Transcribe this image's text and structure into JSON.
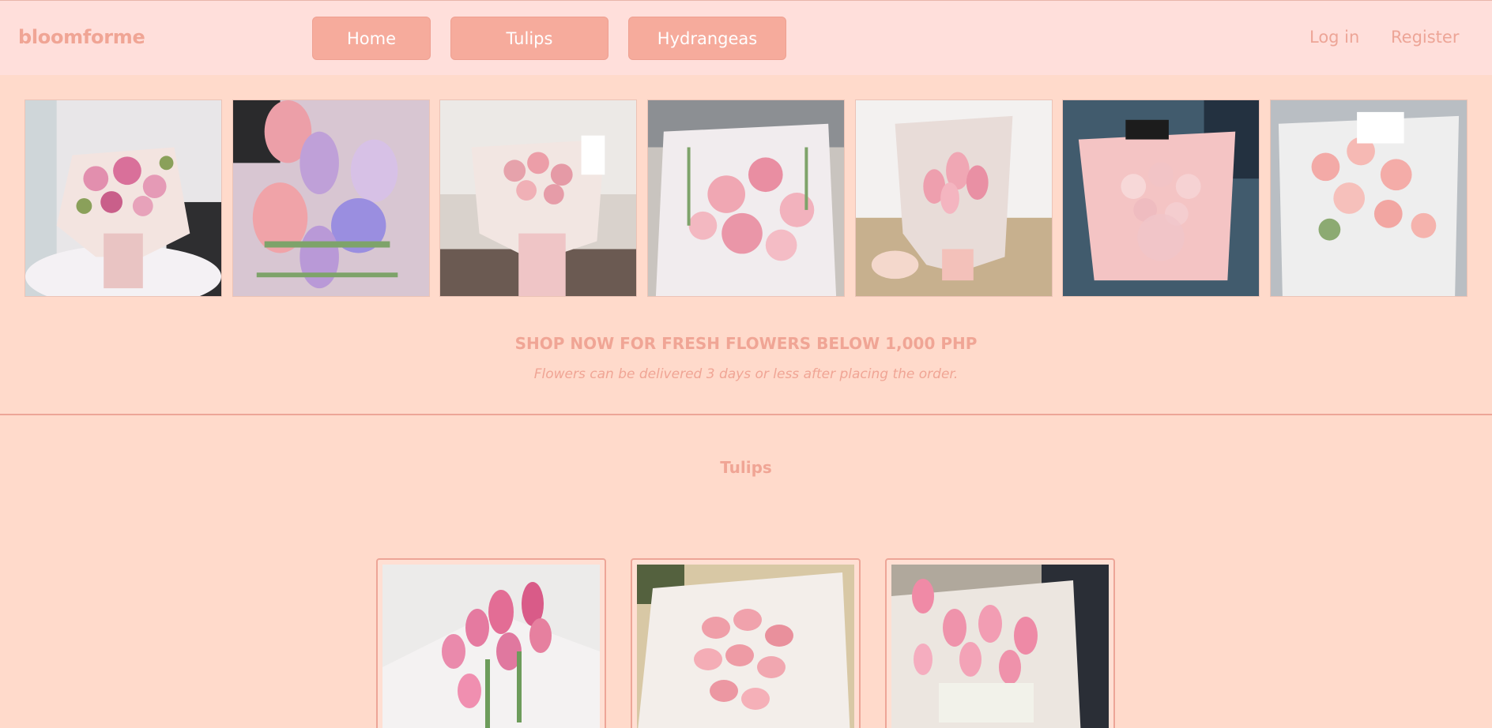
{
  "header": {
    "logo": "bloomforme",
    "nav": [
      "Home",
      "Tulips",
      "Hydrangeas"
    ],
    "auth": {
      "login": "Log in",
      "register": "Register"
    }
  },
  "gallery": {
    "images": [
      "pink lily bouquet",
      "pink and purple tulips",
      "pink rose bouquet",
      "pink carnation bouquet",
      "pink tulip bouquet in hand",
      "pink roses with baby's breath",
      "peach carnation bouquet"
    ]
  },
  "promo": {
    "title": "SHOP NOW FOR FRESH FLOWERS BELOW 1,000 PHP",
    "subtitle": "Flowers can be delivered 3 days or less after placing the order."
  },
  "section": {
    "title": "Tulips"
  },
  "products": [
    {
      "image": "pink tulips on white"
    },
    {
      "image": "pink tulips in paper wrap"
    },
    {
      "image": "pink tulips bouquet dark background"
    }
  ],
  "colors": {
    "background": "#ffdacb",
    "header": "#ffdfdb",
    "accent": "#f6ab9c",
    "text_accent": "#f0a595"
  }
}
